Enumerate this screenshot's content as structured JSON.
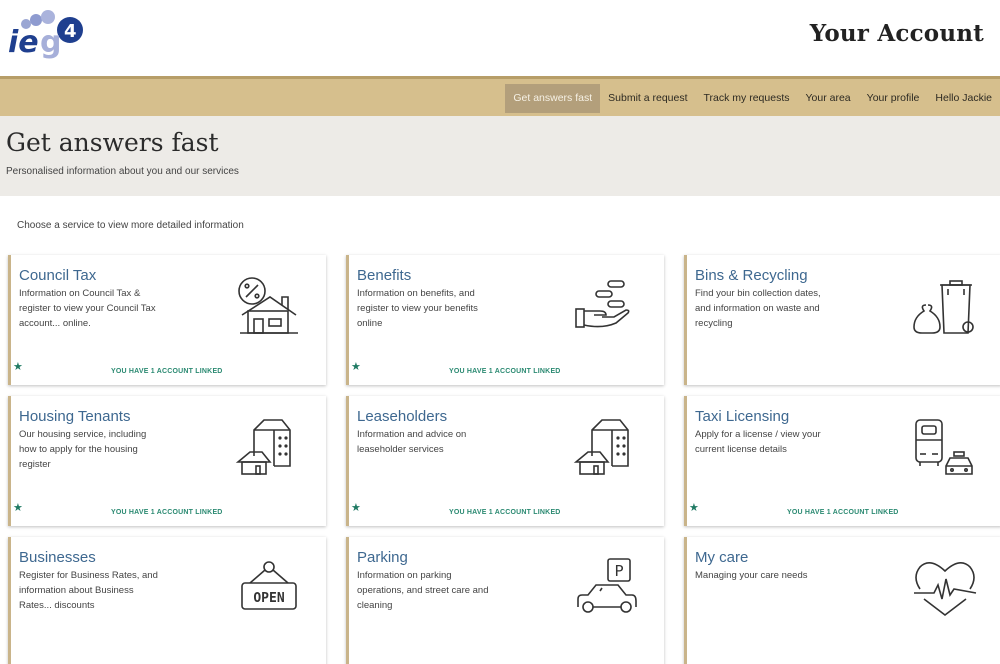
{
  "header": {
    "logo_alt": "ieg4",
    "title": "Your Account"
  },
  "nav": {
    "items": [
      {
        "label": "Get answers fast",
        "active": true
      },
      {
        "label": "Submit a request",
        "active": false
      },
      {
        "label": "Track my requests",
        "active": false
      },
      {
        "label": "Your area",
        "active": false
      },
      {
        "label": "Your profile",
        "active": false
      },
      {
        "label": "Hello Jackie",
        "active": false
      }
    ]
  },
  "hero": {
    "title": "Get answers fast",
    "subtitle": "Personalised information about you and our services"
  },
  "instructions": "Choose a service to view more detailed information",
  "services": [
    {
      "title": "Council Tax",
      "description": "Information on Council Tax & register to view your Council Tax account... online.",
      "icon": "house-percent-icon",
      "linked_text": "YOU HAVE 1 ACCOUNT LINKED",
      "starred": true
    },
    {
      "title": "Benefits",
      "description": "Information on benefits, and register to view your benefits online",
      "icon": "hand-coins-icon",
      "linked_text": "YOU HAVE 1 ACCOUNT LINKED",
      "starred": true
    },
    {
      "title": "Bins & Recycling",
      "description": "Find your bin collection dates, and information on waste and recycling",
      "icon": "wheelie-bin-icon",
      "linked_text": "",
      "starred": false
    },
    {
      "title": "Housing Tenants",
      "description": "Our housing service, including how to apply for the housing register",
      "icon": "buildings-icon",
      "linked_text": "YOU HAVE 1 ACCOUNT LINKED",
      "starred": true
    },
    {
      "title": "Leaseholders",
      "description": "Information and advice on leaseholder services",
      "icon": "buildings-icon",
      "linked_text": "YOU HAVE 1 ACCOUNT LINKED",
      "starred": true
    },
    {
      "title": "Taxi Licensing",
      "description": "Apply for a license / view your current license details",
      "icon": "bus-taxi-icon",
      "linked_text": "YOU HAVE 1 ACCOUNT LINKED",
      "starred": true
    },
    {
      "title": "Businesses",
      "description": "Register for Business Rates, and information about Business Rates... discounts",
      "icon": "open-sign-icon",
      "linked_text": "",
      "starred": false
    },
    {
      "title": "Parking",
      "description": "Information on parking operations, and street care and cleaning",
      "icon": "car-parking-icon",
      "linked_text": "",
      "starred": false
    },
    {
      "title": "My care",
      "description": "Managing your care needs",
      "icon": "heart-pulse-icon",
      "linked_text": "",
      "starred": false
    }
  ],
  "colors": {
    "nav_bg": "#d6bf8d",
    "nav_active": "#b39f7b",
    "title_blue": "#3e6890",
    "linked_green": "#2b8a72"
  }
}
